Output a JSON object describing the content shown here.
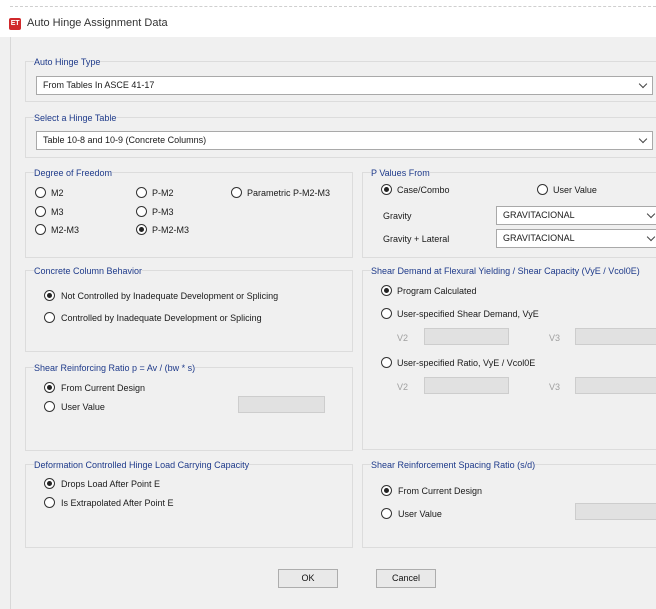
{
  "window": {
    "app_icon": "ET",
    "title": "Auto Hinge Assignment Data"
  },
  "auto_hinge_type": {
    "label": "Auto Hinge Type",
    "value": "From Tables In ASCE 41-17"
  },
  "hinge_table": {
    "label": "Select a Hinge Table",
    "value": "Table 10-8 and 10-9 (Concrete Columns)"
  },
  "dof": {
    "label": "Degree of Freedom",
    "options": [
      "M2",
      "M3",
      "M2-M3",
      "P-M2",
      "P-M3",
      "P-M2-M3",
      "Parametric P-M2-M3"
    ],
    "selected": "P-M2-M3"
  },
  "p_values": {
    "label": "P Values From",
    "option_case": "Case/Combo",
    "option_user": "User Value",
    "selected": "Case/Combo",
    "gravity_label": "Gravity",
    "gravity_value": "GRAVITACIONAL",
    "lateral_label": "Gravity + Lateral",
    "lateral_value": "GRAVITACIONAL"
  },
  "concrete_behavior": {
    "label": "Concrete Column Behavior",
    "option1": "Not Controlled by Inadequate Development or Splicing",
    "option2": "Controlled by Inadequate Development or Splicing",
    "selected": 1
  },
  "shear_demand": {
    "label": "Shear Demand at Flexural Yielding / Shear Capacity (VyE / Vcol0E)",
    "option1": "Program Calculated",
    "option2": "User-specified Shear Demand, VyE",
    "option3": "User-specified Ratio, VyE / Vcol0E",
    "v2": "V2",
    "v3": "V3",
    "selected": 1
  },
  "shear_ratio": {
    "label": "Shear Reinforcing Ratio p = Av / (bw * s)",
    "option1": "From Current Design",
    "option2": "User Value",
    "selected": 1
  },
  "deformation": {
    "label": "Deformation Controlled Hinge Load Carrying Capacity",
    "option1": "Drops Load After Point E",
    "option2": "Is Extrapolated After Point E",
    "selected": 1
  },
  "spacing": {
    "label": "Shear Reinforcement Spacing Ratio (s/d)",
    "option1": "From Current Design",
    "option2": "User Value",
    "selected": 1
  },
  "buttons": {
    "ok": "OK",
    "cancel": "Cancel"
  }
}
